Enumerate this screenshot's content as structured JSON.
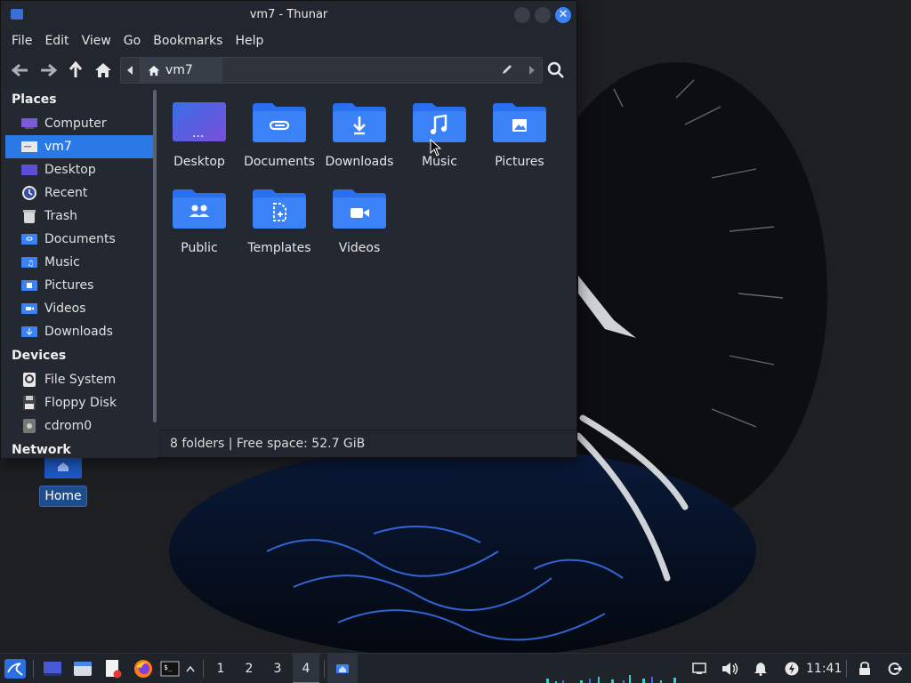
{
  "window": {
    "title": "vm7 - Thunar",
    "close_glyph": "✕"
  },
  "menubar": {
    "items": [
      "File",
      "Edit",
      "View",
      "Go",
      "Bookmarks",
      "Help"
    ]
  },
  "pathbar": {
    "current": "vm7"
  },
  "sidebar": {
    "places_header": "Places",
    "places": [
      {
        "label": "Computer",
        "icon": "computer-icon"
      },
      {
        "label": "vm7",
        "icon": "home-folder-icon",
        "active": true
      },
      {
        "label": "Desktop",
        "icon": "desktop-icon"
      },
      {
        "label": "Recent",
        "icon": "recent-icon"
      },
      {
        "label": "Trash",
        "icon": "trash-icon"
      },
      {
        "label": "Documents",
        "icon": "documents-folder-icon"
      },
      {
        "label": "Music",
        "icon": "music-folder-icon"
      },
      {
        "label": "Pictures",
        "icon": "pictures-folder-icon"
      },
      {
        "label": "Videos",
        "icon": "videos-folder-icon"
      },
      {
        "label": "Downloads",
        "icon": "downloads-folder-icon"
      }
    ],
    "devices_header": "Devices",
    "devices": [
      {
        "label": "File System",
        "icon": "filesystem-icon"
      },
      {
        "label": "Floppy Disk",
        "icon": "floppy-icon"
      },
      {
        "label": "cdrom0",
        "icon": "cdrom-icon"
      }
    ],
    "network_header": "Network"
  },
  "main": {
    "folders": [
      {
        "label": "Desktop",
        "icon": "desktop-folder-icon"
      },
      {
        "label": "Documents",
        "icon": "documents-folder-icon"
      },
      {
        "label": "Downloads",
        "icon": "downloads-folder-icon"
      },
      {
        "label": "Music",
        "icon": "music-folder-icon"
      },
      {
        "label": "Pictures",
        "icon": "pictures-folder-icon"
      },
      {
        "label": "Public",
        "icon": "public-folder-icon"
      },
      {
        "label": "Templates",
        "icon": "templates-folder-icon"
      },
      {
        "label": "Videos",
        "icon": "videos-folder-icon"
      }
    ]
  },
  "status": {
    "text": "8 folders  |  Free space: 52.7 GiB"
  },
  "desktop": {
    "home_label": "Home"
  },
  "taskbar": {
    "workspaces": [
      "1",
      "2",
      "3",
      "4"
    ],
    "active_workspace": "4",
    "clock": "11:41"
  },
  "colors": {
    "accent": "#2b79e6",
    "folder": "#3b82f6",
    "window_bg": "#242831"
  }
}
